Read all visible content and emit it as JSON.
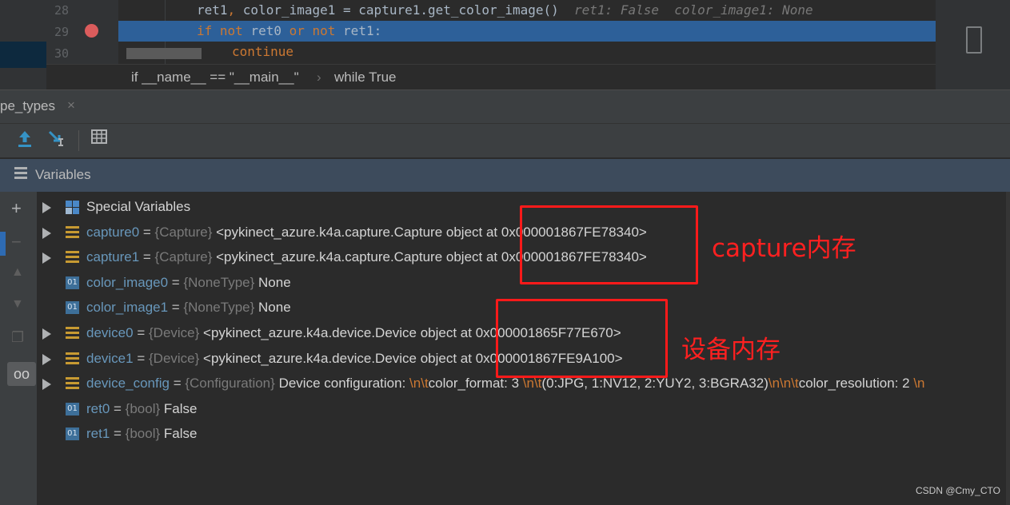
{
  "editor": {
    "lines": [
      {
        "num": "28",
        "code_parts": [
          {
            "t": "ret1",
            "c": "txt"
          },
          {
            "t": ", ",
            "c": "kw"
          },
          {
            "t": "color_image1 = capture1.get_color_image()  ",
            "c": "txt"
          },
          {
            "t": "ret1: False  color_image1: None",
            "c": "hint"
          }
        ]
      },
      {
        "num": "29",
        "code_parts": [
          {
            "t": "if not ",
            "c": "kw"
          },
          {
            "t": "ret0 ",
            "c": "txt"
          },
          {
            "t": "or not ",
            "c": "kw"
          },
          {
            "t": "ret1:",
            "c": "txt"
          }
        ]
      },
      {
        "num": "30",
        "code_parts": [
          {
            "t": "continue",
            "c": "kw"
          }
        ]
      }
    ],
    "breadcrumb": [
      "if __name__ == \"__main__\"",
      "while True"
    ]
  },
  "tab": {
    "label": "pe_types",
    "close": "×"
  },
  "toolbar": {
    "icons": [
      "upload-arrow-icon",
      "step-into-icon",
      "table-icon"
    ]
  },
  "variables": {
    "title": "Variables",
    "rows": [
      {
        "expandable": true,
        "icon": "grid",
        "name": "Special Variables",
        "type": "",
        "value": "",
        "name_plain": true
      },
      {
        "expandable": true,
        "icon": "list",
        "name": "capture0",
        "type": "{Capture}",
        "value": "<pykinect_azure.k4a.capture.Capture object at 0x000001867FE78340>"
      },
      {
        "expandable": true,
        "icon": "list",
        "name": "capture1",
        "type": "{Capture}",
        "value": "<pykinect_azure.k4a.capture.Capture object at 0x000001867FE78340>"
      },
      {
        "expandable": false,
        "icon": "01",
        "name": "color_image0",
        "type": "{NoneType}",
        "value": "None"
      },
      {
        "expandable": false,
        "icon": "01",
        "name": "color_image1",
        "type": "{NoneType}",
        "value": "None"
      },
      {
        "expandable": true,
        "icon": "list",
        "name": "device0",
        "type": "{Device}",
        "value": "<pykinect_azure.k4a.device.Device object at 0x000001865F77E670>"
      },
      {
        "expandable": true,
        "icon": "list",
        "name": "device1",
        "type": "{Device}",
        "value": "<pykinect_azure.k4a.device.Device object at 0x000001867FE9A100>"
      },
      {
        "expandable": true,
        "icon": "list",
        "name": "device_config",
        "type": "{Configuration}",
        "value_parts": [
          {
            "t": "Device configuration: ",
            "c": "vval"
          },
          {
            "t": "\\n\\t",
            "c": "esc"
          },
          {
            "t": "color_format: 3 ",
            "c": "vval"
          },
          {
            "t": "\\n\\t",
            "c": "esc"
          },
          {
            "t": "(0:JPG, 1:NV12, 2:YUY2, 3:BGRA32)",
            "c": "vval"
          },
          {
            "t": "\\n\\n\\t",
            "c": "esc"
          },
          {
            "t": "color_resolution: 2 ",
            "c": "vval"
          },
          {
            "t": "\\n",
            "c": "esc"
          }
        ]
      },
      {
        "expandable": false,
        "icon": "01",
        "name": "ret0",
        "type": "{bool}",
        "value": "False"
      },
      {
        "expandable": false,
        "icon": "01",
        "name": "ret1",
        "type": "{bool}",
        "value": "False"
      }
    ]
  },
  "annotations": {
    "capture_label": "capture内存",
    "device_label": "设备内存",
    "annotation_color": "#ff1a1a"
  },
  "watermark": "CSDN @Cmy_CTO"
}
